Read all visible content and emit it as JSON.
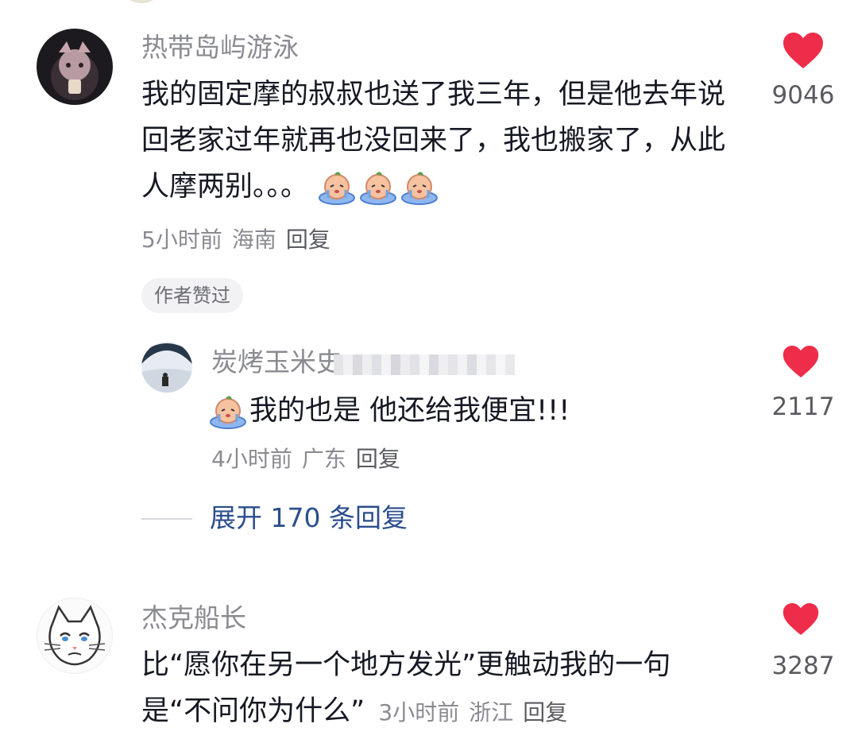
{
  "comments": [
    {
      "username": "热带岛屿游泳",
      "text": "我的固定摩的叔叔也送了我三年，但是他去年说回老家过年就再也没回来了，我也搬家了，从此人摩两别。。。",
      "emoji_name": "crying-emoji",
      "time": "5小时前",
      "location": "海南",
      "reply_label": "回复",
      "badge": "作者赞过",
      "likes": "9046",
      "reply": {
        "username": "炭烤玉米史",
        "text": "我的也是 他还给我便宜!!!",
        "emoji_name": "crying-emoji",
        "time": "4小时前",
        "location": "广东",
        "reply_label": "回复",
        "likes": "2117"
      },
      "expand_label": "展开 170 条回复"
    },
    {
      "username": "杰克船长",
      "text": "比“愿你在另一个地方发光”更触动我的一句是“不问你为什么”",
      "time": "3小时前",
      "location": "浙江",
      "reply_label": "回复",
      "likes": "3287"
    }
  ],
  "colors": {
    "heart": "#ee2d4a",
    "username": "#8a8b91",
    "text": "#161823",
    "expand": "#2b4e8c"
  }
}
